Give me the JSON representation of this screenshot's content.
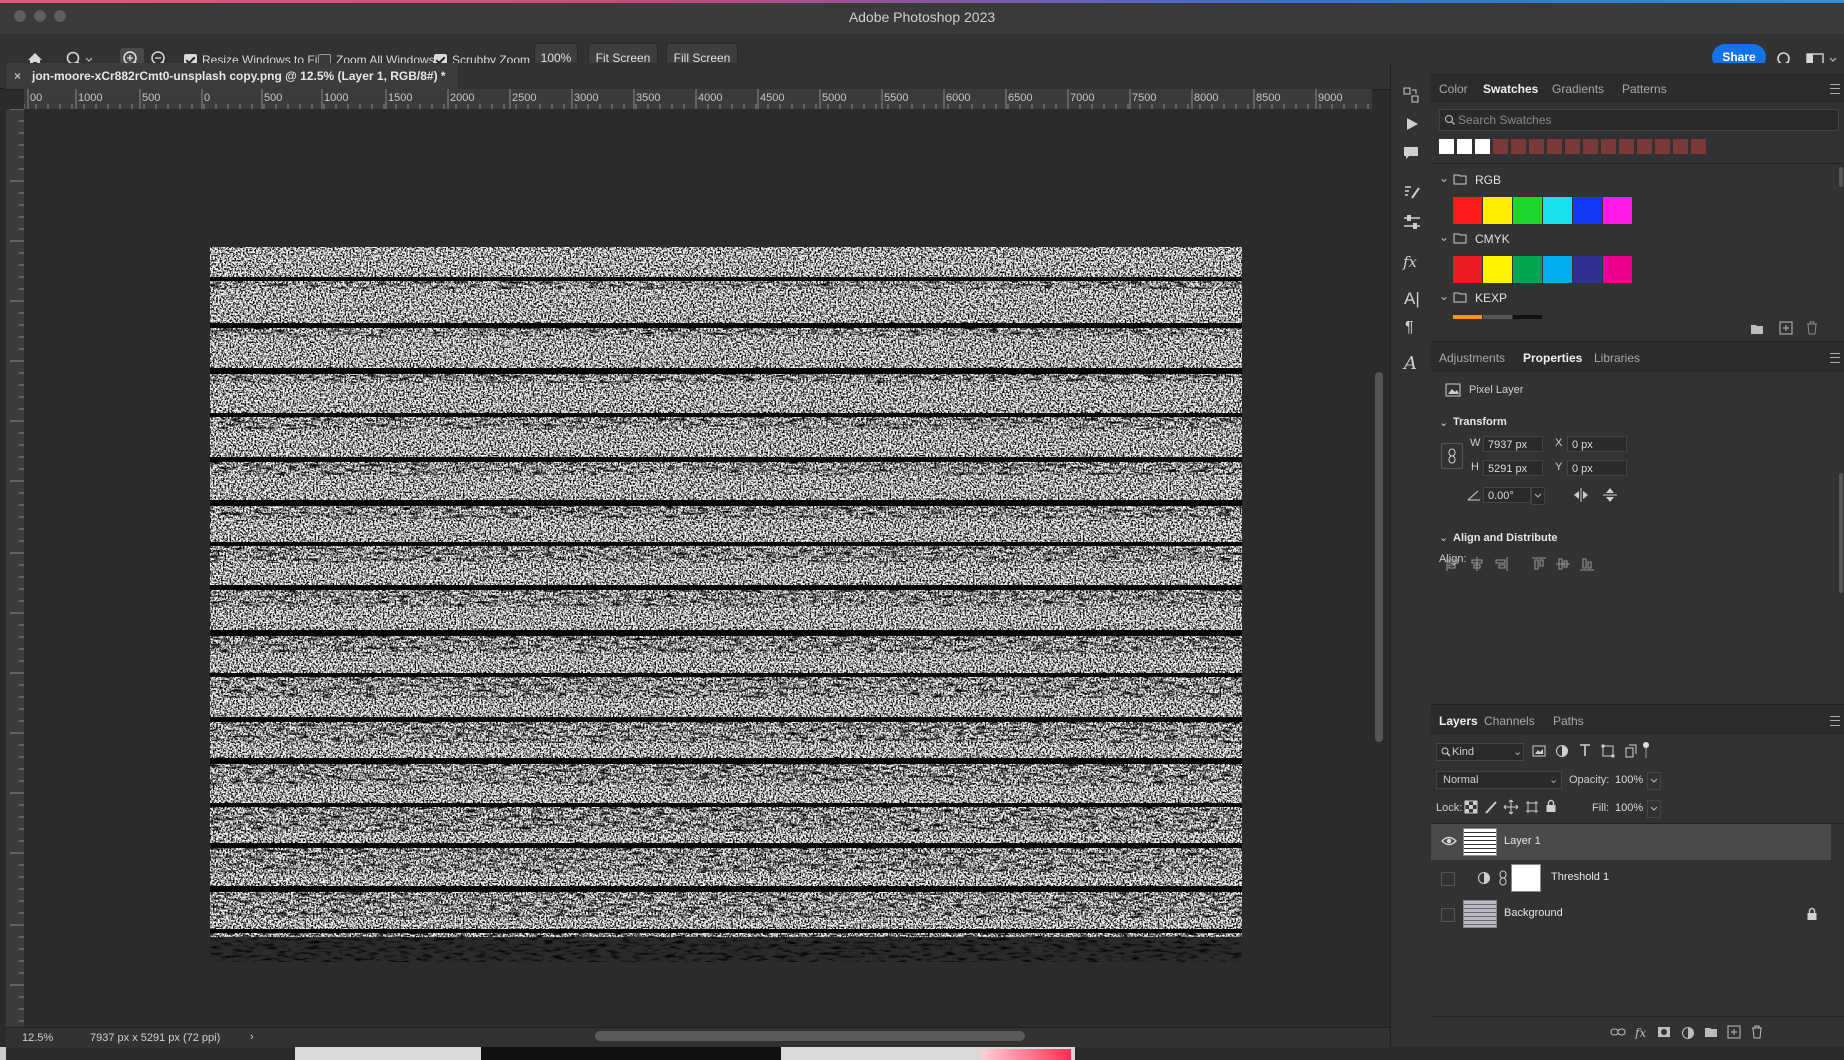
{
  "app": {
    "title": "Adobe Photoshop 2023"
  },
  "options_bar": {
    "resize_windows_label": "Resize Windows to Fit",
    "zoom_all_label": "Zoom All Windows",
    "scrubby_zoom_label": "Scrubby Zoom",
    "zoom_value": "100%",
    "fit_screen": "Fit Screen",
    "fill_screen": "Fill Screen",
    "share": "Share",
    "resize_windows_checked": true,
    "zoom_all_checked": false,
    "scrubby_zoom_checked": true
  },
  "document": {
    "tab_title": "jon-moore-xCr882rCmt0-unsplash copy.png @ 12.5% (Layer 1, RGB/8#) *",
    "close_glyph": "×"
  },
  "ruler": {
    "h_labels": [
      "00",
      "1000",
      "500",
      "0",
      "500",
      "1000",
      "1500",
      "2000",
      "2500",
      "3000",
      "3500",
      "4000",
      "4500",
      "5000",
      "5500",
      "6000",
      "6500",
      "7000",
      "7500",
      "8000",
      "8500",
      "9000"
    ]
  },
  "status": {
    "zoom": "12.5%",
    "dimensions": "7937 px x 5291 px (72 ppi)",
    "arrow": "›"
  },
  "swatches_panel": {
    "tabs": [
      "Color",
      "Swatches",
      "Gradients",
      "Patterns"
    ],
    "active_tab": "Swatches",
    "search_placeholder": "Search Swatches",
    "groups": [
      {
        "name": "RGB",
        "colors": [
          "#ff1a1a",
          "#ffee00",
          "#1fd62c",
          "#14e1ec",
          "#1436f5",
          "#ff1ae8"
        ]
      },
      {
        "name": "CMYK",
        "colors": [
          "#ed1c24",
          "#fff200",
          "#00a651",
          "#00aeef",
          "#2e3192",
          "#ec008c"
        ]
      },
      {
        "name": "KEXP",
        "colors": [
          "#f7941d",
          "#555555",
          "#111111"
        ]
      }
    ]
  },
  "properties_panel": {
    "tabs": [
      "Adjustments",
      "Properties",
      "Libraries"
    ],
    "active_tab": "Properties",
    "layer_kind": "Pixel Layer",
    "transform_title": "Transform",
    "w_label": "W",
    "w_value": "7937 px",
    "h_label": "H",
    "h_value": "5291 px",
    "x_label": "X",
    "x_value": "0 px",
    "y_label": "Y",
    "y_value": "0 px",
    "angle_value": "0.00°",
    "align_title": "Align and Distribute",
    "align_label": "Align:"
  },
  "layers_panel": {
    "tabs": [
      "Layers",
      "Channels",
      "Paths"
    ],
    "active_tab": "Layers",
    "filter_kind": "Kind",
    "blend_mode": "Normal",
    "opacity_label": "Opacity:",
    "opacity_value": "100%",
    "lock_label": "Lock:",
    "fill_label": "Fill:",
    "fill_value": "100%",
    "layers": [
      {
        "name": "Layer 1",
        "visible": true,
        "selected": true
      },
      {
        "name": "Threshold 1",
        "visible": false,
        "selected": false
      },
      {
        "name": "Background",
        "visible": false,
        "selected": false,
        "locked": true
      }
    ]
  }
}
